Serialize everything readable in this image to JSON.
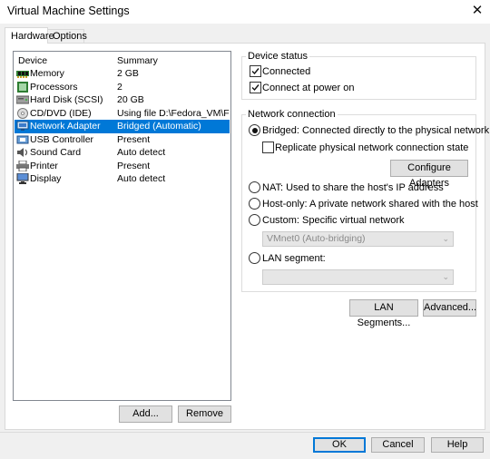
{
  "window": {
    "title": "Virtual Machine Settings",
    "close_glyph": "✕"
  },
  "tabs": [
    {
      "label": "Hardware"
    },
    {
      "label": "Options"
    }
  ],
  "device_list": {
    "columns": {
      "device": "Device",
      "summary": "Summary"
    },
    "rows": [
      {
        "name": "Memory",
        "summary": "2 GB",
        "icon": "memory-icon"
      },
      {
        "name": "Processors",
        "summary": "2",
        "icon": "processor-icon"
      },
      {
        "name": "Hard Disk (SCSI)",
        "summary": "20 GB",
        "icon": "hard-disk-icon"
      },
      {
        "name": "CD/DVD (IDE)",
        "summary": "Using file D:\\Fedora_VM\\Fed...",
        "icon": "cd-dvd-icon"
      },
      {
        "name": "Network Adapter",
        "summary": "Bridged (Automatic)",
        "icon": "network-adapter-icon",
        "selected": true
      },
      {
        "name": "USB Controller",
        "summary": "Present",
        "icon": "usb-icon"
      },
      {
        "name": "Sound Card",
        "summary": "Auto detect",
        "icon": "sound-card-icon"
      },
      {
        "name": "Printer",
        "summary": "Present",
        "icon": "printer-icon"
      },
      {
        "name": "Display",
        "summary": "Auto detect",
        "icon": "display-icon"
      }
    ],
    "add_label": "Add...",
    "remove_label": "Remove"
  },
  "device_status": {
    "title": "Device status",
    "connected": {
      "label": "Connected",
      "checked": true
    },
    "connect_at_power_on": {
      "label": "Connect at power on",
      "checked": true
    }
  },
  "network_connection": {
    "title": "Network connection",
    "bridged": {
      "label": "Bridged: Connected directly to the physical network",
      "selected": true
    },
    "replicate": {
      "label": "Replicate physical network connection state",
      "checked": false
    },
    "configure_adapters_label": "Configure Adapters",
    "nat": {
      "label": "NAT: Used to share the host's IP address",
      "selected": false
    },
    "host_only": {
      "label": "Host-only: A private network shared with the host",
      "selected": false
    },
    "custom": {
      "label": "Custom: Specific virtual network",
      "selected": false
    },
    "custom_select": {
      "value": "VMnet0 (Auto-bridging)"
    },
    "lan_segment": {
      "label": "LAN segment:",
      "selected": false
    },
    "lan_segment_select": {
      "value": ""
    }
  },
  "lan_segments_label": "LAN Segments...",
  "advanced_label": "Advanced...",
  "footer": {
    "ok_label": "OK",
    "cancel_label": "Cancel",
    "help_label": "Help"
  },
  "colors": {
    "selection": "#0078d7",
    "dialog_bg": "#f0f0f0",
    "button_bg": "#e1e1e1"
  }
}
